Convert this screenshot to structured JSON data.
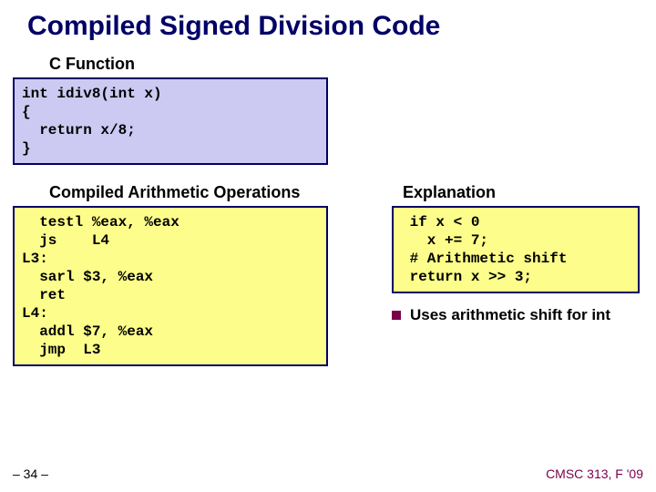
{
  "title": "Compiled Signed Division Code",
  "sections": {
    "cfunc_label": "C Function",
    "cfunc_code": "int idiv8(int x)\n{\n  return x/8;\n}",
    "compiled_label": "Compiled Arithmetic Operations",
    "compiled_code": "  testl %eax, %eax\n  js    L4\nL3:\n  sarl $3, %eax\n  ret\nL4:\n  addl $7, %eax\n  jmp  L3",
    "explanation_label": "Explanation",
    "explanation_code": " if x < 0\n   x += 7;\n # Arithmetic shift\n return x >> 3;"
  },
  "bullet": "Uses arithmetic shift for int",
  "footer": {
    "left": "– 34 –",
    "right": "CMSC 313, F '09"
  }
}
